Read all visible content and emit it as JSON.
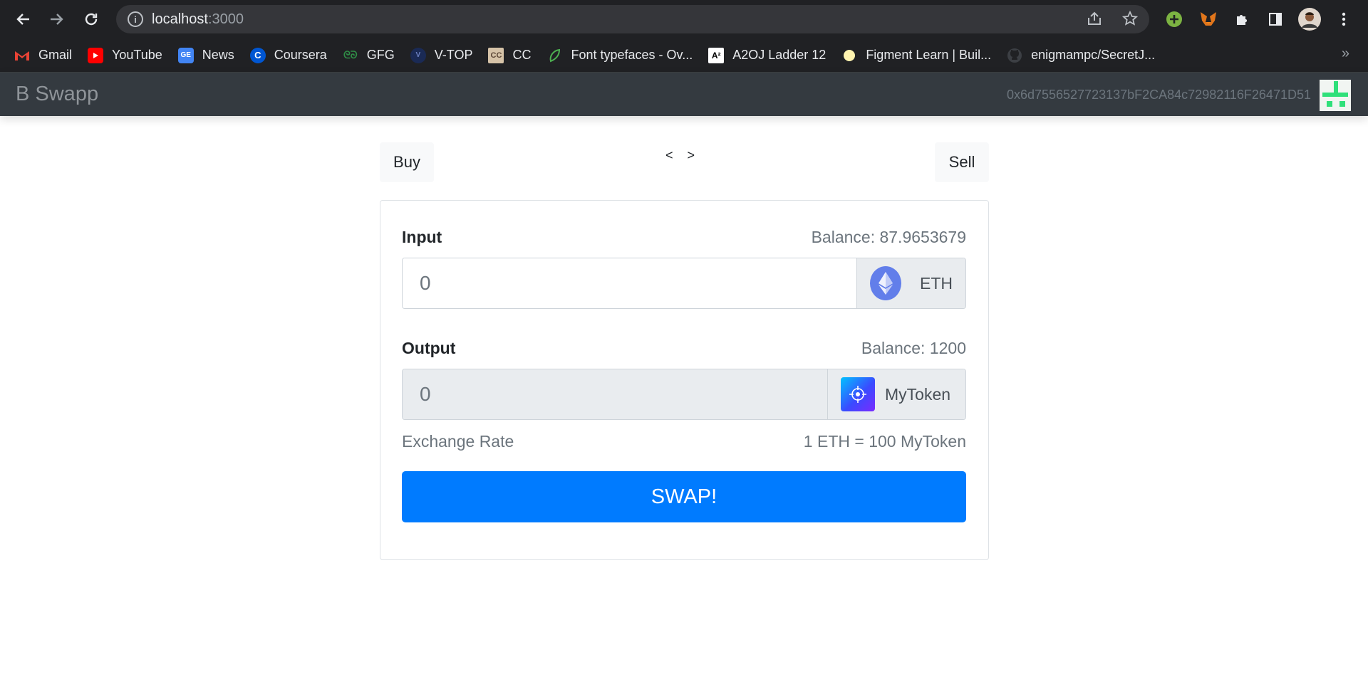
{
  "browser": {
    "url_host": "localhost",
    "url_port": ":3000",
    "bookmarks": [
      {
        "label": "Gmail",
        "icon": "gmail-icon"
      },
      {
        "label": "YouTube",
        "icon": "youtube-icon"
      },
      {
        "label": "News",
        "icon": "google-news-icon"
      },
      {
        "label": "Coursera",
        "icon": "coursera-icon"
      },
      {
        "label": "GFG",
        "icon": "gfg-icon"
      },
      {
        "label": "V-TOP",
        "icon": "vtop-icon"
      },
      {
        "label": "CC",
        "icon": "codechef-icon"
      },
      {
        "label": "Font typefaces - Ov...",
        "icon": "leaf-icon"
      },
      {
        "label": "A2OJ Ladder 12",
        "icon": "a2oj-icon"
      },
      {
        "label": "Figment Learn | Buil...",
        "icon": "figment-icon"
      },
      {
        "label": "enigmampc/SecretJ...",
        "icon": "github-icon"
      }
    ],
    "more_symbol": "»"
  },
  "navbar": {
    "brand": "B Swapp",
    "account": "0x6d7556527723137bF2CA84c72982116F26471D51"
  },
  "tabs": {
    "buy": "Buy",
    "sell": "Sell",
    "prev": "<",
    "next": ">"
  },
  "form": {
    "input_label": "Input",
    "input_balance": "Balance: 87.9653679",
    "input_value": "0",
    "input_token": "ETH",
    "output_label": "Output",
    "output_balance": "Balance: 1200",
    "output_value": "0",
    "output_token": "MyToken",
    "rate_label": "Exchange Rate",
    "rate_value": "1 ETH = 100 MyToken",
    "swap_label": "SWAP!"
  },
  "colors": {
    "primary": "#007bff",
    "navbar": "#343a40",
    "eth": "#627eea"
  }
}
